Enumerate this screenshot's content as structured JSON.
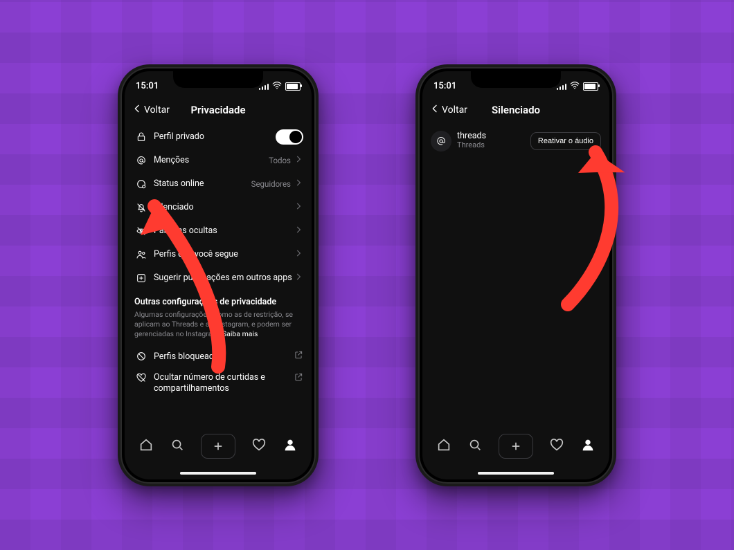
{
  "status": {
    "time": "15:01"
  },
  "left": {
    "back": "Voltar",
    "title": "Privacidade",
    "rows": {
      "private": "Perfil privado",
      "mentions": {
        "label": "Menções",
        "value": "Todos"
      },
      "online": {
        "label": "Status online",
        "value": "Seguidores"
      },
      "muted": "Silenciado",
      "hidden": "Palavras ocultas",
      "follows": "Perfis que você segue",
      "suggest": "Sugerir publicações em outros apps"
    },
    "section": {
      "title": "Outras configurações de privacidade",
      "desc": "Algumas configurações, como as de restrição, se aplicam ao Threads e ao Instagram, e podem ser gerenciadas no Instagram. ",
      "more": "Saiba mais"
    },
    "extra": {
      "blocked": "Perfis bloqueados",
      "hidelikes": "Ocultar número de curtidas e compartilhamentos"
    }
  },
  "right": {
    "back": "Voltar",
    "title": "Silenciado",
    "item": {
      "username": "threads",
      "display": "Threads",
      "action": "Reativar o áudio"
    }
  }
}
